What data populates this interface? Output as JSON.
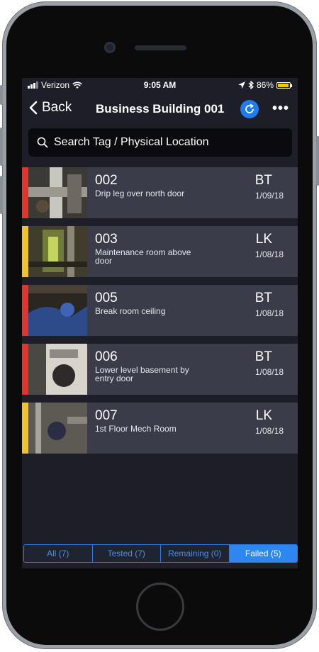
{
  "status_bar": {
    "carrier": "Verizon",
    "time": "9:05 AM",
    "battery_pct": "86%"
  },
  "nav": {
    "back_label": "Back",
    "title": "Business Building 001"
  },
  "search": {
    "placeholder": "Search Tag / Physical Location"
  },
  "items": [
    {
      "tag": "002",
      "desc": "Drip leg over north door",
      "initials": "BT",
      "date": "1/09/18",
      "flag_color": "#e0342c"
    },
    {
      "tag": "003",
      "desc": "Maintenance room above door",
      "initials": "LK",
      "date": "1/08/18",
      "flag_color": "#f2c22e"
    },
    {
      "tag": "005",
      "desc": "Break room ceiling",
      "initials": "BT",
      "date": "1/08/18",
      "flag_color": "#e0342c"
    },
    {
      "tag": "006",
      "desc": "Lower level basement by entry door",
      "initials": "BT",
      "date": "1/08/18",
      "flag_color": "#e0342c"
    },
    {
      "tag": "007",
      "desc": "1st Floor Mech Room",
      "initials": "LK",
      "date": "1/08/18",
      "flag_color": "#f2c22e"
    }
  ],
  "tabs": [
    {
      "label": "All (7)",
      "active": false
    },
    {
      "label": "Tested (7)",
      "active": false
    },
    {
      "label": "Remaining (0)",
      "active": false
    },
    {
      "label": "Failed (5)",
      "active": true
    }
  ],
  "colors": {
    "accent": "#2e86f0",
    "fail": "#e0342c",
    "warn": "#f2c22e"
  }
}
